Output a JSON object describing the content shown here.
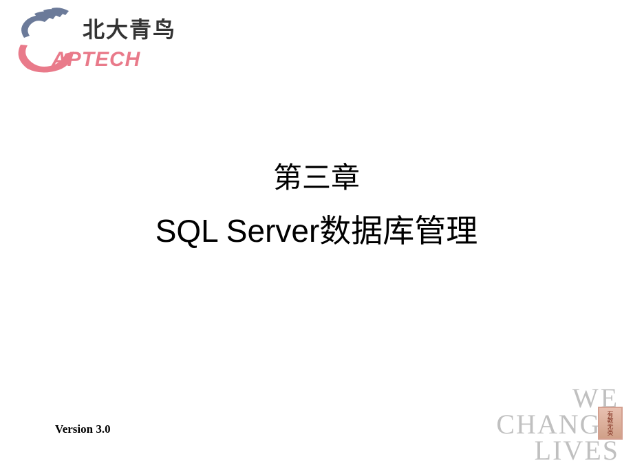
{
  "logo": {
    "cn_text": "北大青鸟",
    "en_text": "APTECH"
  },
  "chapter": "第三章",
  "title": "SQL Server数据库管理",
  "version": "Version  3.0",
  "tagline": {
    "line1": "WE",
    "line2": "CHANGE",
    "line3": "LIVES"
  },
  "seal_text": "有教无类"
}
